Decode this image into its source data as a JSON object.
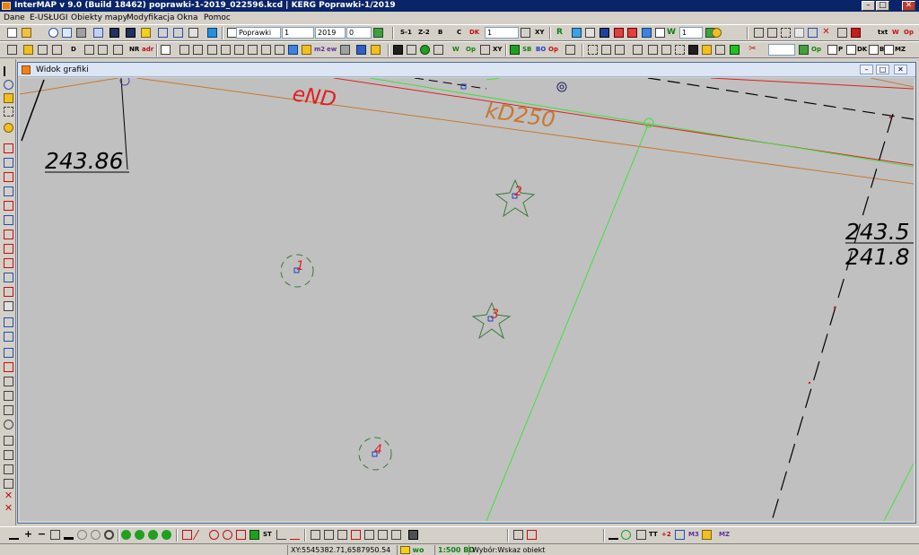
{
  "window": {
    "title": "InterMAP v 9.0 (Build 18462)   poprawki-1-2019_022596.kcd | KERG Poprawki-1/2019",
    "minimize": "–",
    "maximize": "□",
    "close": "✕"
  },
  "menu": {
    "items": [
      "Dane",
      "E-USŁUGI",
      "Obiekty mapy",
      "Modyfikacja",
      "Okna",
      "Pomoc"
    ]
  },
  "toolbar1": {
    "layer_combo": "Poprawki",
    "number_field": "1",
    "year_field": "2019",
    "zero_field": "0",
    "s1": "S-1",
    "z2": "Z-2",
    "b": "B",
    "c": "C",
    "dk": "DK",
    "scale_field": "1",
    "xy": "XY",
    "r_label": "R",
    "count_field": "1",
    "txt": "txt",
    "w": "W",
    "op": "Op"
  },
  "toolbar2": {
    "d_label": "D",
    "nr": "NR",
    "adr": "adr",
    "m2": "m2",
    "ew": "ew",
    "op": "Op",
    "xy": "XY",
    "sb": "SB",
    "bo": "BO",
    "op2": "Op",
    "p": "P",
    "dk": "DK",
    "b": "B",
    "mz": "MZ"
  },
  "graphic_window": {
    "title": "Widok grafiki",
    "minimize": "–",
    "maximize": "□",
    "close": "✕"
  },
  "map": {
    "labels": {
      "end": "eND",
      "kd250": "kD250",
      "height1": "243.86",
      "height2": "243.5",
      "height3": "241.8",
      "p1": "1",
      "p2": "2",
      "p3": "3",
      "p4": "4"
    },
    "colors": {
      "background": "#c0c0c0",
      "red": "#e02020",
      "orange": "#c87830",
      "green": "#40e040",
      "black": "#000000",
      "point": "#3a7a3a",
      "marker": "#2040c0"
    }
  },
  "bottom_toolbar": {
    "st": "ST",
    "tt": "TT",
    "plus2": "+2",
    "m3": "M3",
    "mz": "MZ"
  },
  "status": {
    "coords": "XY:5545382.71,6587950.54",
    "mode": "wo",
    "scale": "1:500 BD",
    "hint": "Wybór:Wskaz obiekt"
  }
}
